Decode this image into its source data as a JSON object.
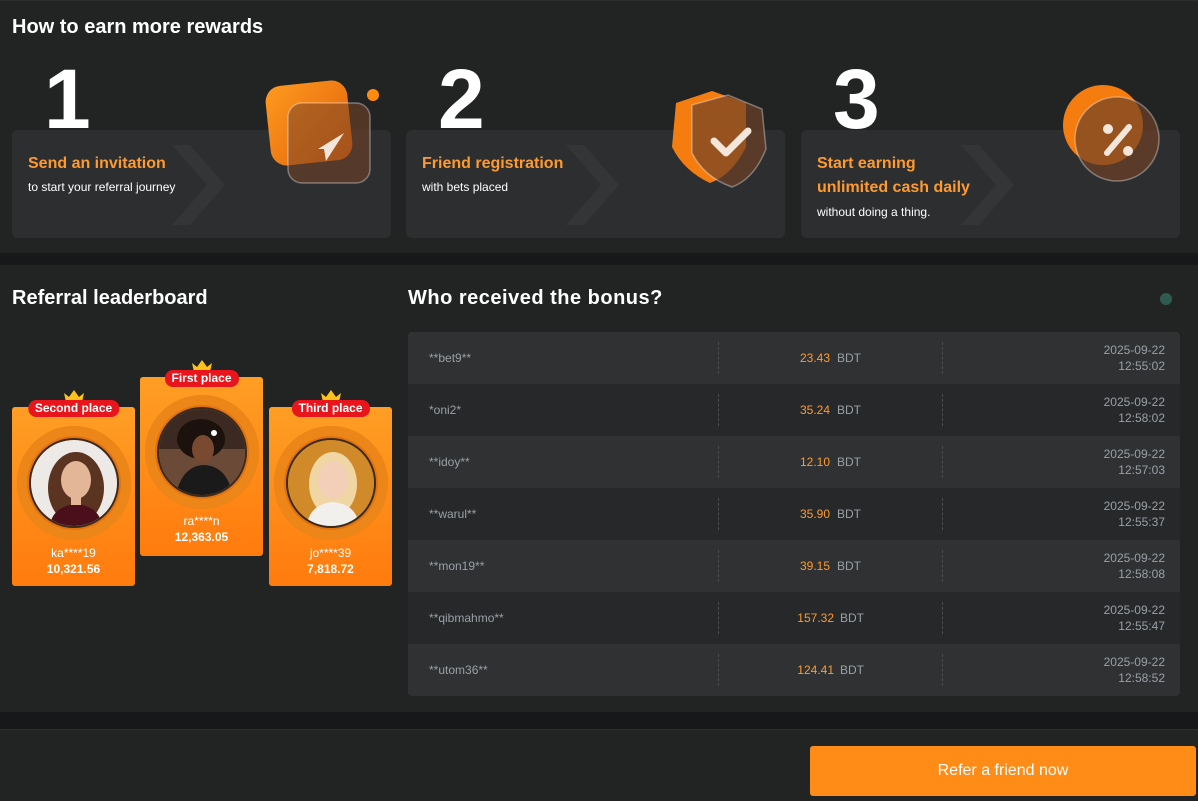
{
  "earn": {
    "title": "How to earn more rewards",
    "steps": [
      {
        "number": "1",
        "heading": "Send an invitation",
        "sub": "to start your referral journey",
        "icon": "paper-plane-icon"
      },
      {
        "number": "2",
        "heading": "Friend registration",
        "sub": "with bets placed",
        "icon": "check-badge-icon"
      },
      {
        "number": "3",
        "heading_line1": "Start earning",
        "heading_line2": "unlimited cash daily",
        "sub": "without doing a thing.",
        "icon": "percent-badge-icon"
      }
    ]
  },
  "leaderboard": {
    "title": "Referral leaderboard",
    "podium": [
      {
        "badge": "Second place",
        "name": "ka****19",
        "score": "10,321.56"
      },
      {
        "badge": "First place",
        "name": "ra****n",
        "score": "12,363.05"
      },
      {
        "badge": "Third place",
        "name": "jo****39",
        "score": "7,818.72"
      }
    ]
  },
  "bonus": {
    "title": "Who received the bonus?",
    "rows": [
      {
        "user": "**bet9**",
        "amount": "23.43",
        "currency": "BDT",
        "date": "2025-09-22",
        "time": "12:55:02"
      },
      {
        "user": "*oni2*",
        "amount": "35.24",
        "currency": "BDT",
        "date": "2025-09-22",
        "time": "12:58:02"
      },
      {
        "user": "**idoy**",
        "amount": "12.10",
        "currency": "BDT",
        "date": "2025-09-22",
        "time": "12:57:03"
      },
      {
        "user": "**warul**",
        "amount": "35.90",
        "currency": "BDT",
        "date": "2025-09-22",
        "time": "12:55:37"
      },
      {
        "user": "**mon19**",
        "amount": "39.15",
        "currency": "BDT",
        "date": "2025-09-22",
        "time": "12:58:08"
      },
      {
        "user": "**qibmahmo**",
        "amount": "157.32",
        "currency": "BDT",
        "date": "2025-09-22",
        "time": "12:55:47"
      },
      {
        "user": "**utom36**",
        "amount": "124.41",
        "currency": "BDT",
        "date": "2025-09-22",
        "time": "12:58:52"
      }
    ]
  },
  "footer": {
    "refer_label": "Refer a friend now"
  },
  "colors": {
    "accent": "#ff8c17",
    "badge_red": "#e8151c",
    "background": "#222424"
  }
}
